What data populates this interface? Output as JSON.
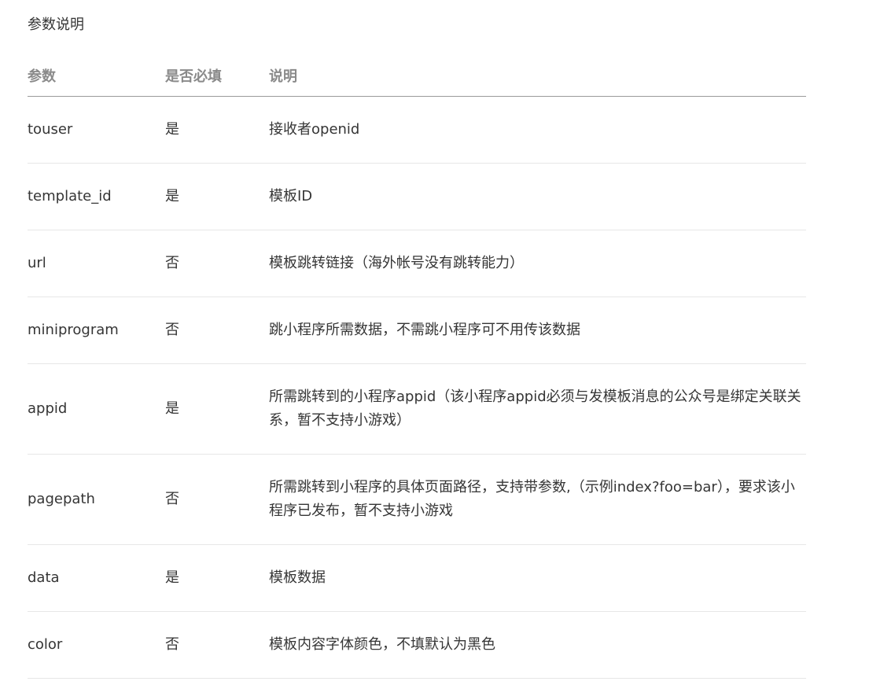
{
  "section_title": "参数说明",
  "headers": {
    "param": "参数",
    "required": "是否必填",
    "desc": "说明"
  },
  "rows": [
    {
      "param": "touser",
      "required": "是",
      "desc": "接收者openid"
    },
    {
      "param": "template_id",
      "required": "是",
      "desc": "模板ID"
    },
    {
      "param": "url",
      "required": "否",
      "desc": "模板跳转链接（海外帐号没有跳转能力）"
    },
    {
      "param": "miniprogram",
      "required": "否",
      "desc": "跳小程序所需数据，不需跳小程序可不用传该数据"
    },
    {
      "param": "appid",
      "required": "是",
      "desc": "所需跳转到的小程序appid（该小程序appid必须与发模板消息的公众号是绑定关联关系，暂不支持小游戏）"
    },
    {
      "param": "pagepath",
      "required": "否",
      "desc": "所需跳转到小程序的具体页面路径，支持带参数,（示例index?foo=bar），要求该小程序已发布，暂不支持小游戏"
    },
    {
      "param": "data",
      "required": "是",
      "desc": "模板数据"
    },
    {
      "param": "color",
      "required": "否",
      "desc": "模板内容字体颜色，不填默认为黑色"
    }
  ]
}
